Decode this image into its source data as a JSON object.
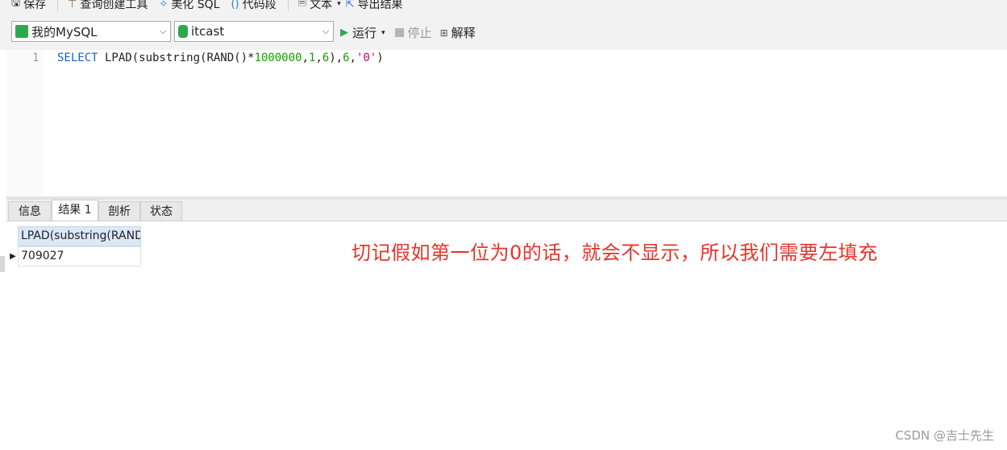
{
  "toolbar": {
    "items": [
      {
        "label": "保存",
        "icon": "save-icon"
      },
      {
        "label": "查询创建工具",
        "icon": "query-builder-icon"
      },
      {
        "label": "美化 SQL",
        "icon": "beautify-icon"
      },
      {
        "label": "代码段",
        "icon": "code-snippet-icon"
      },
      {
        "label": "文本",
        "icon": "text-icon"
      },
      {
        "label": "导出结果",
        "icon": "export-icon"
      }
    ]
  },
  "connection": {
    "value": "我的MySQL",
    "icon_color": "#2fa84f"
  },
  "database": {
    "value": "itcast",
    "icon_color": "#2fa84f"
  },
  "actions": {
    "run": "运行",
    "stop": "停止",
    "explain": "解释"
  },
  "editor": {
    "line_number": "1",
    "code": {
      "kw": "SELECT",
      "p1": " LPAD(substring(RAND()*",
      "n1": "1000000",
      "p2": ",",
      "n2": "1",
      "p3": ",",
      "n3": "6",
      "p4": "),",
      "n4": "6",
      "p5": ",",
      "s1": "'0'",
      "p6": ")"
    }
  },
  "tabs": [
    "信息",
    "结果 1",
    "剖析",
    "状态"
  ],
  "result": {
    "column": "LPAD(substring(RAND",
    "value": "709027"
  },
  "note": "切记假如第一位为0的话，就会不显示，所以我们需要左填充",
  "watermark": "CSDN @吉士先生",
  "colors": {
    "note": "#e8332a",
    "keyword": "#1a5fd1",
    "number": "#13a000",
    "string": "#d0006f"
  }
}
